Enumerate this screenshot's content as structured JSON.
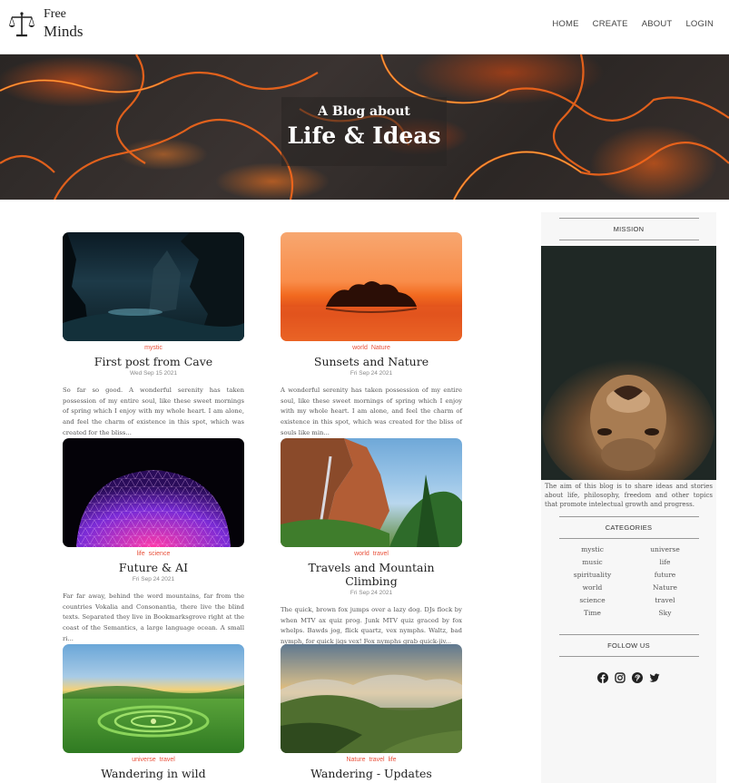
{
  "brand": {
    "line1": "Free",
    "line2": "Minds"
  },
  "nav": [
    "HOME",
    "CREATE",
    "ABOUT",
    "LOGIN"
  ],
  "hero": {
    "subtitle": "A Blog about",
    "title": "Life & Ideas"
  },
  "posts": [
    {
      "tags": [
        "mystic"
      ],
      "title": "First post from Cave",
      "date": "Wed Sep 15 2021",
      "excerpt": "So far so good. A wonderful serenity has taken possession of my entire soul, like these sweet mornings of spring which I enjoy with my whole heart. I am alone, and feel the charm of existence in this spot, which was created for the bliss..."
    },
    {
      "tags": [
        "world",
        "Nature"
      ],
      "title": "Sunsets and Nature",
      "date": "Fri Sep 24 2021",
      "excerpt": "A wonderful serenity has taken possession of my entire soul, like these sweet mornings of spring which I enjoy with my whole heart. I am alone, and feel the charm of existence in this spot, which was created for the bliss of souls like min..."
    },
    {
      "tags": [
        "life",
        "science"
      ],
      "title": "Future & AI",
      "date": "Fri Sep 24 2021",
      "excerpt": "Far far away, behind the word mountains, far from the countries Vokalia and Consonantia, there live the blind texts. Separated they live in Bookmarksgrove right at the coast of the Semantics, a large language ocean. A small ri..."
    },
    {
      "tags": [
        "world",
        "travel"
      ],
      "title": "Travels and Mountain Climbing",
      "date": "Fri Sep 24 2021",
      "excerpt": "The quick, brown fox jumps over a lazy dog. DJs flock by when MTV ax quiz prog. Junk MTV quiz graced by fox whelps. Bawds jog, flick quartz, vex nymphs. Waltz, bad nymph, for quick jigs vex! Fox nymphs grab quick-jiv..."
    },
    {
      "tags": [
        "universe",
        "travel"
      ],
      "title": "Wandering in wild",
      "date": "",
      "excerpt": ""
    },
    {
      "tags": [
        "Nature",
        "travel",
        "life"
      ],
      "title": "Wandering - Updates",
      "date": "",
      "excerpt": ""
    }
  ],
  "sidebar": {
    "mission_heading": "MISSION",
    "about": "The aim of this blog is to share ideas and stories about life, philosophy, freedom and other topics that promote intelectual growth and progress.",
    "categories_heading": "CATEGORIES",
    "categories": [
      "mystic",
      "universe",
      "music",
      "life",
      "spirituality",
      "future",
      "world",
      "Nature",
      "science",
      "travel",
      "Time",
      "Sky"
    ],
    "follow_heading": "FOLLOW US",
    "social_icons": [
      "facebook-icon",
      "instagram-icon",
      "pinterest-icon",
      "twitter-icon"
    ]
  },
  "colors": {
    "accent": "#e8503a",
    "text": "#333333",
    "sidebar_bg": "#f7f7f7"
  }
}
